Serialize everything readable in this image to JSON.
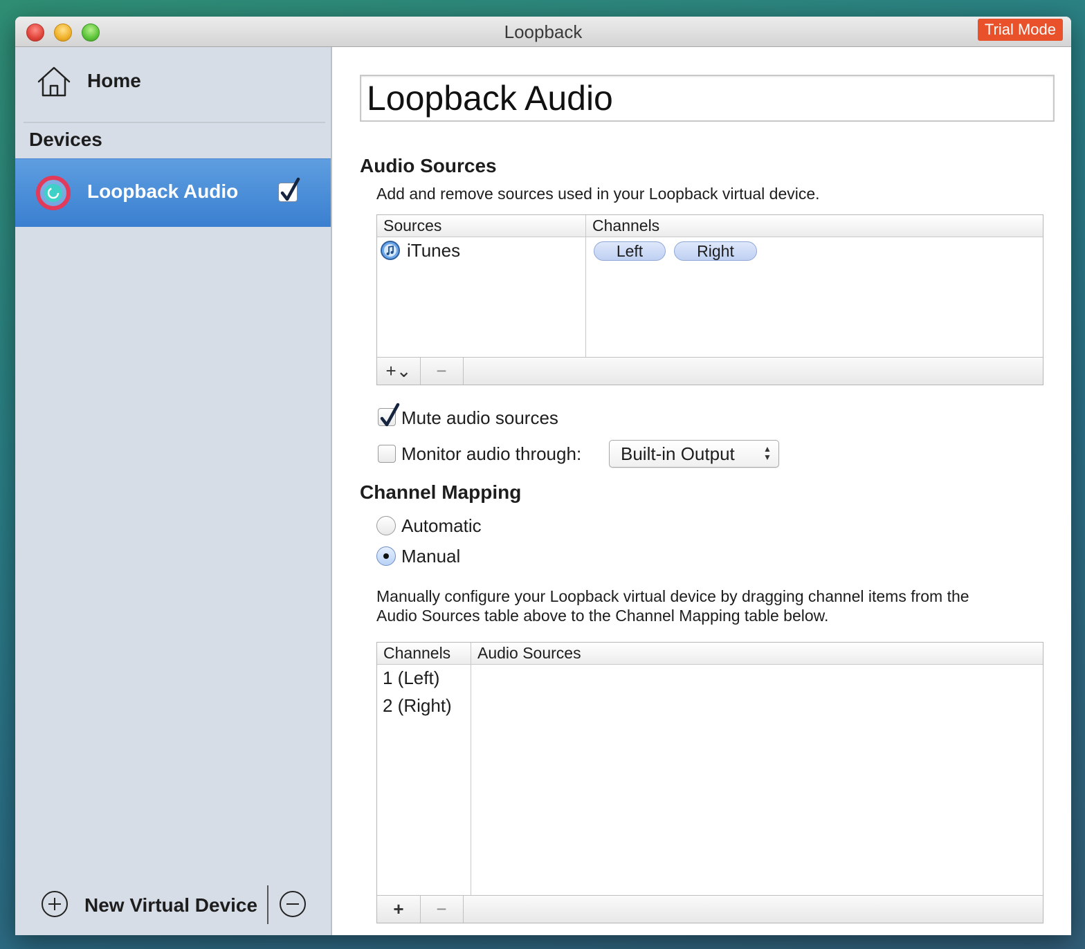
{
  "window": {
    "title": "Loopback",
    "trial_badge": "Trial Mode"
  },
  "sidebar": {
    "home_label": "Home",
    "devices_header": "Devices",
    "devices": [
      {
        "label": "Loopback Audio",
        "checked": true,
        "selected": true
      }
    ],
    "new_device_label": "New Virtual Device"
  },
  "device": {
    "name": "Loopback Audio"
  },
  "audio_sources": {
    "title": "Audio Sources",
    "description": "Add and remove sources used in your Loopback virtual device.",
    "columns": [
      "Sources",
      "Channels"
    ],
    "rows": [
      {
        "source": "iTunes",
        "channels": [
          "Left",
          "Right"
        ]
      }
    ],
    "add_button": "+⌄",
    "remove_button": "−"
  },
  "options": {
    "mute_label": "Mute audio sources",
    "mute_checked": true,
    "monitor_label": "Monitor audio through:",
    "monitor_checked": false,
    "monitor_device": "Built-in Output"
  },
  "channel_mapping": {
    "title": "Channel Mapping",
    "modes": [
      "Automatic",
      "Manual"
    ],
    "selected_mode": "Manual",
    "description_line1": "Manually configure your Loopback virtual device by dragging channel items from the",
    "description_line2": "Audio Sources table above to the Channel Mapping table below.",
    "columns": [
      "Channels",
      "Audio Sources"
    ],
    "rows": [
      "1 (Left)",
      "2 (Right)"
    ],
    "add_button": "+",
    "remove_button": "−"
  },
  "colors": {
    "accent": "#3a7fd0",
    "trial_badge": "#e8512a",
    "sidebar_bg": "#d6dde6"
  }
}
